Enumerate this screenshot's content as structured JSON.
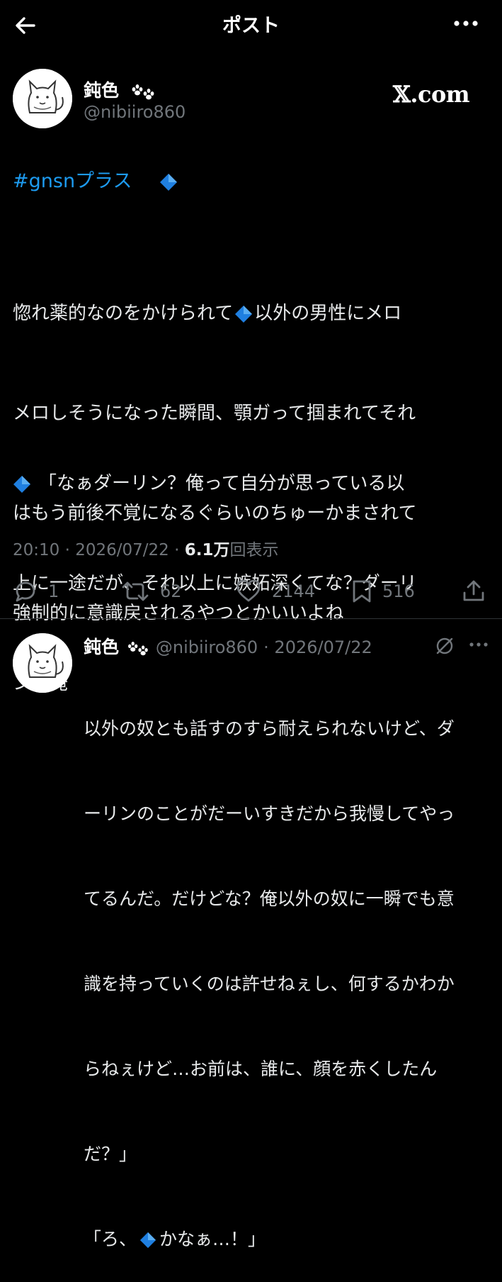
{
  "header": {
    "title": "ポスト"
  },
  "post": {
    "author_name": "鈍色",
    "handle": "@nibiiro860",
    "source": "𝕏.com",
    "hashtag": "#gnsnプラス",
    "para1_lines": [
      "惚れ薬的なのをかけられて",
      "メロしそうになった瞬間、顎ガって掴まれてそれ",
      "はもう前後不覚になるぐらいのちゅーかまされて",
      "強制的に意識戻されるやつとかいいよね"
    ],
    "para1_after_diamond": "以外の男性にメロ",
    "para2_first": "「なぁダーリン？俺って自分が思っている以",
    "para2_lines": [
      "上に一途だが、それ以上に嫉妬深くてな？ダーリ",
      "ンが俺"
    ],
    "time": "20:10",
    "date": "2026/07/22",
    "views_count": "6.1万",
    "views_label": "回表示",
    "stats": {
      "replies": "1",
      "reposts": "62",
      "likes": "2144",
      "bookmarks": "516"
    },
    "accent_color": "#1d9bf0",
    "diamond_color": "#1f7fe0"
  },
  "reply": {
    "author_name": "鈍色",
    "handle": "@nibiiro860",
    "date": "2026/07/22",
    "lines": [
      "以外の奴とも話すのすら耐えられないけど、ダ",
      "ーリンのことがだーいすきだから我慢してやっ",
      "てるんだ。だけどな？俺以外の奴に一瞬でも意",
      "識を持っていくのは許せねぇし、何するかわか",
      "らねぇけど…お前は、誰に、顔を赤くしたん",
      "だ？」"
    ],
    "line7_prefix": "「ろ、",
    "line7_suffix": "かなぁ…！」"
  }
}
